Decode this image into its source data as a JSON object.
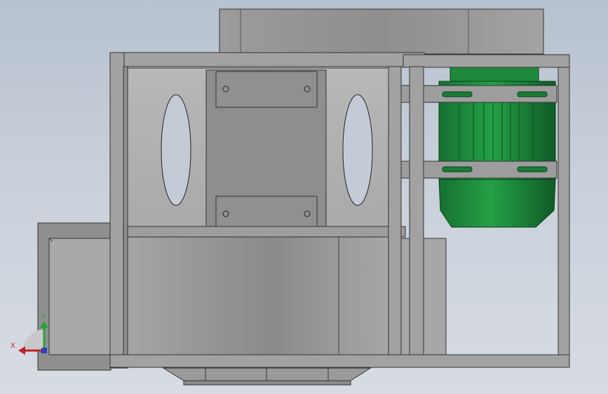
{
  "view": {
    "background_top": "#b7c1cf",
    "background_bottom": "#d7dce3",
    "part_color": "#9a9a9a",
    "motor_color": "#1f7a36"
  },
  "triad": {
    "x_label": "X",
    "y_label": "Y",
    "x_color": "#c0202a",
    "y_color": "#22a33a",
    "z_color": "#2a3fc0"
  }
}
